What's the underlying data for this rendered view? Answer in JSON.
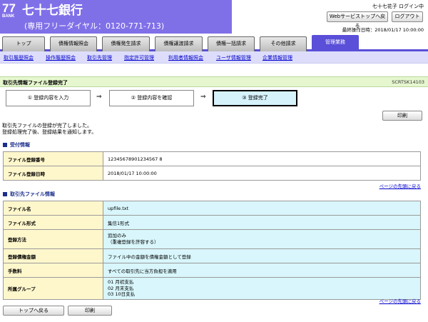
{
  "header": {
    "logo_number": "77",
    "logo_sub": "BANK",
    "bank_name": "七十七銀行",
    "free_dial": "(専用フリーダイヤル：0120-771-713)",
    "user_status": "七十七花子 ログイン中",
    "web_top_button": "Webサービストップへ戻る",
    "logout_button": "ログアウト",
    "last_operation": "最終操作日時：2018/01/17 10:00:00"
  },
  "tabs": [
    {
      "label": "トップ"
    },
    {
      "label": "債権情報照会"
    },
    {
      "label": "債権発生請求"
    },
    {
      "label": "債権譲渡請求"
    },
    {
      "label": "債権一括請求"
    },
    {
      "label": "その他請求"
    },
    {
      "label": "管理業務"
    }
  ],
  "subnav": [
    {
      "label": "取引履歴照会"
    },
    {
      "label": "操作履歴照会"
    },
    {
      "label": "取引先管理"
    },
    {
      "label": "指定許可管理"
    },
    {
      "label": "利用者情報照会"
    },
    {
      "label": "ユーザ情報管理"
    },
    {
      "label": "企業情報管理"
    }
  ],
  "page": {
    "title": "取引先情報ファイル登録完了",
    "code": "SCRTSK14103"
  },
  "steps": [
    {
      "label": "① 登録内容を入力"
    },
    {
      "label": "② 登録内容を確認"
    },
    {
      "label": "③ 登録完了"
    }
  ],
  "print_button": "印刷",
  "message_line1": "取引先ファイルの登録が完了しました。",
  "message_line2": "登録処理完了後、登録結果を通知します。",
  "reception": {
    "heading": "受付情報",
    "rows": [
      {
        "label": "ファイル登録番号",
        "value": "12345678901234567 8"
      },
      {
        "label": "ファイル登録日時",
        "value": "2018/01/17 10:00:00"
      }
    ]
  },
  "back_to_top_link": "ページの先頭に戻る",
  "file_info": {
    "heading": "取引先ファイル情報",
    "rows": [
      {
        "label": "ファイル名",
        "value": "upfile.txt"
      },
      {
        "label": "ファイル形式",
        "value": "集信1形式"
      },
      {
        "label": "登録方法",
        "value": "追加のみ",
        "value2": "（重複登録を許容する）"
      },
      {
        "label": "登録債権金額",
        "value": "ファイル中の金額を債権金額として登録"
      },
      {
        "label": "手数料",
        "value": "すべての取引先に当方負担を適用"
      },
      {
        "label": "所属グループ",
        "value": "01 月初支払",
        "value2": "02 月末支払",
        "value3": "03 10日支払"
      }
    ]
  },
  "footer": {
    "top_button": "トップへ戻る",
    "print_button": "印刷"
  }
}
